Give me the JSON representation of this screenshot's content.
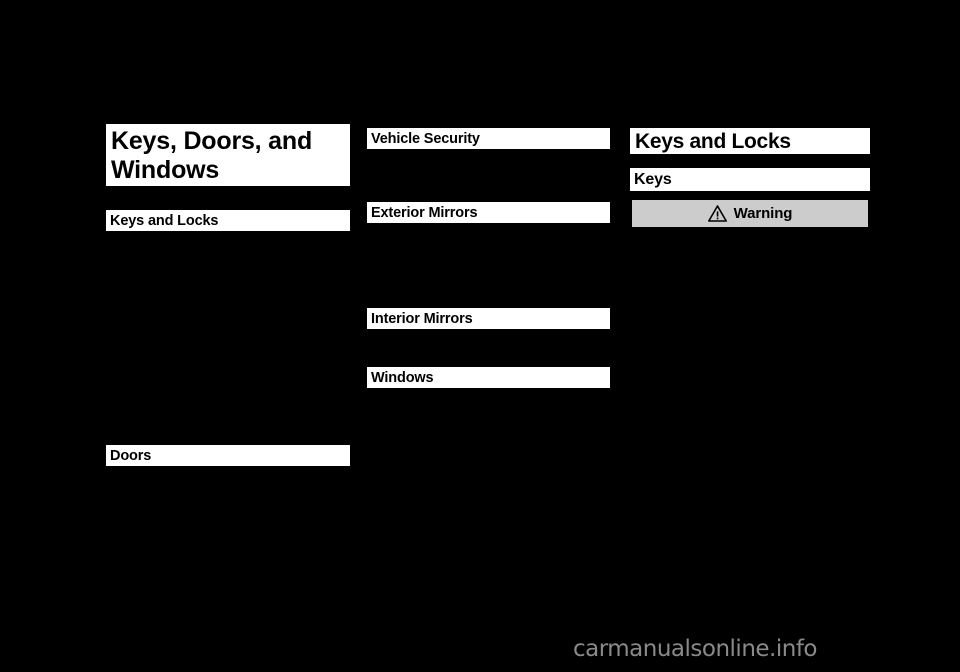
{
  "document": {
    "type": "vehicle-owner-manual-page",
    "watermark": "carmanualsonline.info",
    "background_color": "#000000",
    "bar_color": "#ffffff",
    "warning_fill_color": "#cccccc",
    "watermark_color": "#8a8a8a"
  },
  "column_1": {
    "chapter_title": "Keys, Doors, and Windows",
    "sections": [
      {
        "heading": "Keys and Locks"
      },
      {
        "heading": "Doors"
      }
    ]
  },
  "column_2": {
    "sections": [
      {
        "heading": "Vehicle Security"
      },
      {
        "heading": "Exterior Mirrors"
      },
      {
        "heading": "Interior Mirrors"
      },
      {
        "heading": "Windows"
      }
    ]
  },
  "column_3": {
    "chapter_heading": "Keys and Locks",
    "section_heading": "Keys",
    "warning": {
      "label": "Warning",
      "icon": "warning-triangle-icon"
    }
  }
}
